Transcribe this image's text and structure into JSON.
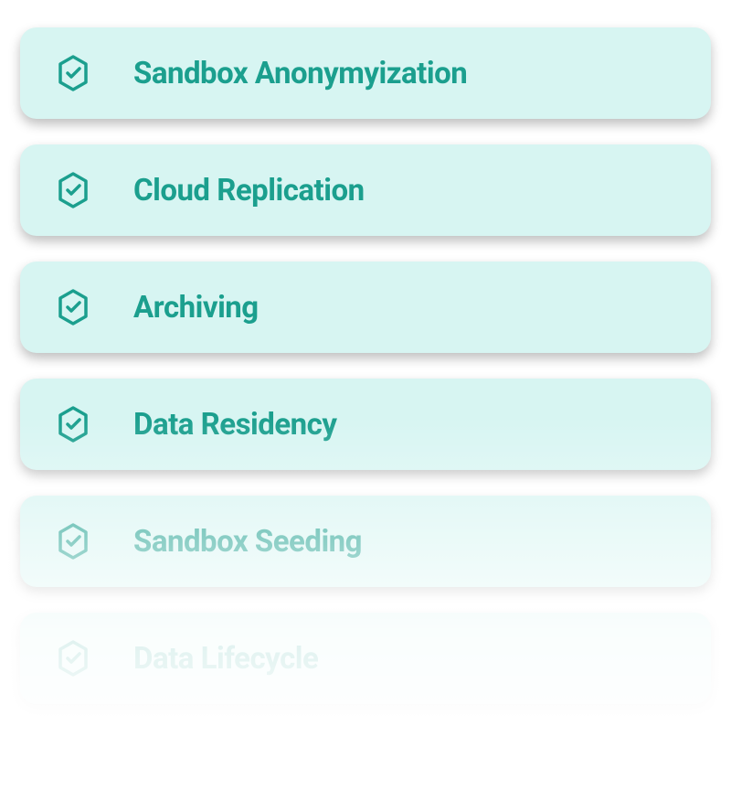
{
  "features": {
    "items": [
      {
        "label": "Sandbox Anonymyization"
      },
      {
        "label": "Cloud Replication"
      },
      {
        "label": "Archiving"
      },
      {
        "label": "Data Residency"
      },
      {
        "label": "Sandbox Seeding"
      },
      {
        "label": "Data Lifecycle"
      }
    ]
  },
  "colors": {
    "card_bg": "#d7f5f2",
    "accent": "#1b9f8e"
  }
}
